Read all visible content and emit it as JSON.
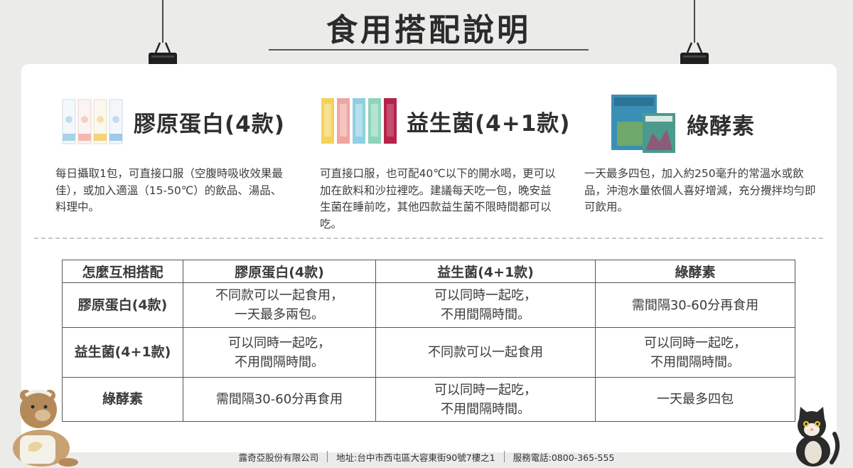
{
  "title": "食用搭配說明",
  "products": [
    {
      "name": "膠原蛋白(4款)",
      "icon": "collagen-sticks-icon",
      "description": "每日攝取1包，可直接口服（空腹時吸收效果最佳），或加入適溫（15-50℃）的飲品、湯品、料理中。"
    },
    {
      "name": "益生菌(4+1款)",
      "icon": "probiotic-sticks-icon",
      "description": "可直接口服，也可配40℃以下的開水喝，更可以加在飲料和沙拉裡吃。建議每天吃一包，晚安益生菌在睡前吃，其他四款益生菌不限時間都可以吃。"
    },
    {
      "name": "綠酵素",
      "icon": "enzyme-box-icon",
      "description": "一天最多四包，加入約250毫升的常溫水或飲品，沖泡水量依個人喜好增減，充分攪拌均勻即可飲用。"
    }
  ],
  "table": {
    "headers": [
      "怎麼互相搭配",
      "膠原蛋白(4款)",
      "益生菌(4+1款)",
      "綠酵素"
    ],
    "rows": [
      {
        "label": "膠原蛋白(4款)",
        "cells": [
          "不同款可以一起食用，\n一天最多兩包。",
          "可以同時一起吃，\n不用間隔時間。",
          "需間隔30-60分再食用"
        ]
      },
      {
        "label": "益生菌(4+1款)",
        "cells": [
          "可以同時一起吃，\n不用間隔時間。",
          "不同款可以一起食用",
          "可以同時一起吃，\n不用間隔時間。"
        ]
      },
      {
        "label": "綠酵素",
        "cells": [
          "需間隔30-60分再食用",
          "可以同時一起吃，\n不用間隔時間。",
          "一天最多四包"
        ]
      }
    ]
  },
  "footer": {
    "company": "露奇亞股份有限公司",
    "address": "地址:台中市西屯區大容東街90號7樓之1",
    "phone": "服務電話:0800-365-555"
  },
  "colors": {
    "background": "#ebebea",
    "card": "#ffffff",
    "text": "#3a3a3a",
    "collagen_sticks": [
      "#a9d3e6",
      "#f3b9b1",
      "#f7d27a",
      "#9ec9e8"
    ],
    "probiotic_sticks": [
      "#f4d25a",
      "#f0a5a0",
      "#8fd0e2",
      "#8fd4b8",
      "#b5224a"
    ],
    "enzyme_box": "#3a8fb5"
  }
}
